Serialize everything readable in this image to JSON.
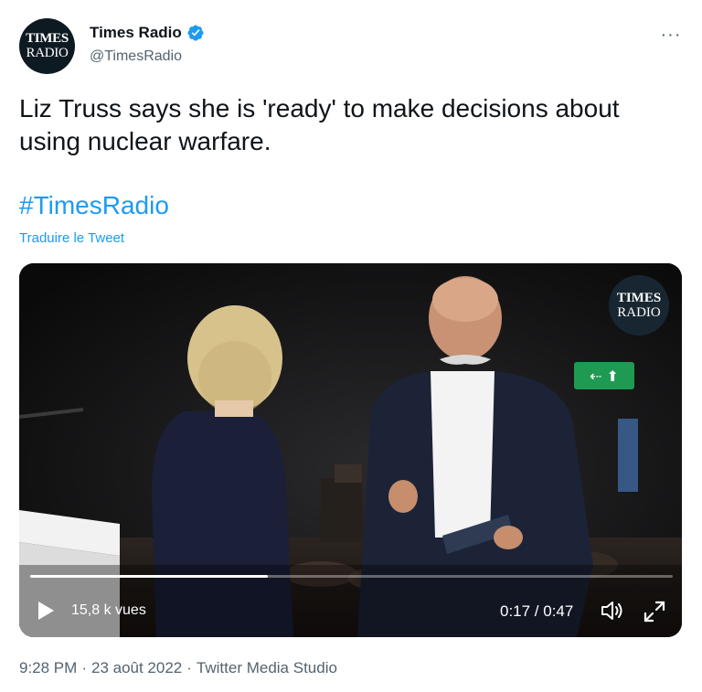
{
  "header": {
    "avatar_line1": "TIMES",
    "avatar_line2": "RADIO",
    "display_name": "Times Radio",
    "handle": "@TimesRadio",
    "more_label": "···"
  },
  "tweet": {
    "text": "Liz Truss says she is 'ready' to make decisions about using nuclear warfare.",
    "hashtag": "#TimesRadio",
    "translate_label": "Traduire le Tweet"
  },
  "video": {
    "watermark_line1": "TIMES",
    "watermark_line2": "RADIO",
    "views": "15,8 k vues",
    "time": "0:17 / 0:47",
    "progress_fraction": 0.37
  },
  "footer": {
    "time": "9:28 PM",
    "date": "23 août 2022",
    "source": "Twitter Media Studio"
  },
  "colors": {
    "accent": "#1d9bf0",
    "secondary_text": "#536471",
    "primary_text": "#0f1419"
  }
}
